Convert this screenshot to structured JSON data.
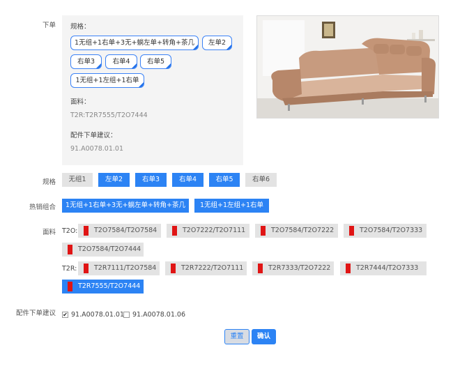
{
  "labels": {
    "order": "下单",
    "spec": "规格",
    "hot_combo": "热销组合",
    "fabric": "面料",
    "parts_suggestion": "配件下单建议"
  },
  "summary": {
    "spec_title": "规格：",
    "spec_pills": [
      "1无组+1右单+3无+躺左单+转角+茶几",
      "左单2",
      "右单3",
      "右单4",
      "右单5",
      "1无组+1左组+1右单"
    ],
    "fabric_title": "面料：",
    "fabric_value": "T2R:T2R7555/T2O7444",
    "parts_title": "配件下单建议：",
    "parts_value": "91.A0078.01.01"
  },
  "spec_options": [
    {
      "label": "无组1",
      "selected": false
    },
    {
      "label": "左单2",
      "selected": true
    },
    {
      "label": "右单3",
      "selected": true
    },
    {
      "label": "右单4",
      "selected": true
    },
    {
      "label": "右单5",
      "selected": true
    },
    {
      "label": "右单6",
      "selected": false
    }
  ],
  "hot_combos": [
    {
      "label": "1无组+1右单+3无+躺左单+转角+茶几",
      "selected": true
    },
    {
      "label": "1无组+1左组+1右单",
      "selected": true
    }
  ],
  "fabric": {
    "t2o_prefix": "T2O:",
    "t2o": [
      {
        "label": "T2O7584/T2O7584",
        "selected": false
      },
      {
        "label": "T2O7222/T2O7111",
        "selected": false
      },
      {
        "label": "T2O7584/T2O7222",
        "selected": false
      },
      {
        "label": "T2O7584/T2O7333",
        "selected": false
      },
      {
        "label": "T2O7584/T2O7444",
        "selected": false
      }
    ],
    "t2r_prefix": "T2R:",
    "t2r": [
      {
        "label": "T2R7111/T2O7584",
        "selected": false
      },
      {
        "label": "T2R7222/T2O7111",
        "selected": false
      },
      {
        "label": "T2R7333/T2O7222",
        "selected": false
      },
      {
        "label": "T2R7444/T2O7333",
        "selected": false
      },
      {
        "label": "T2R7555/T2O7444",
        "selected": true
      }
    ],
    "swatch_color": "#e01515"
  },
  "parts_options": [
    {
      "label": "91.A0078.01.01",
      "checked": true
    },
    {
      "label": "91.A0078.01.06",
      "checked": false
    }
  ],
  "buttons": {
    "reset": "重置",
    "confirm": "确认"
  },
  "colors": {
    "accent": "#2c83f4",
    "unselected": "#e3e3e3"
  }
}
